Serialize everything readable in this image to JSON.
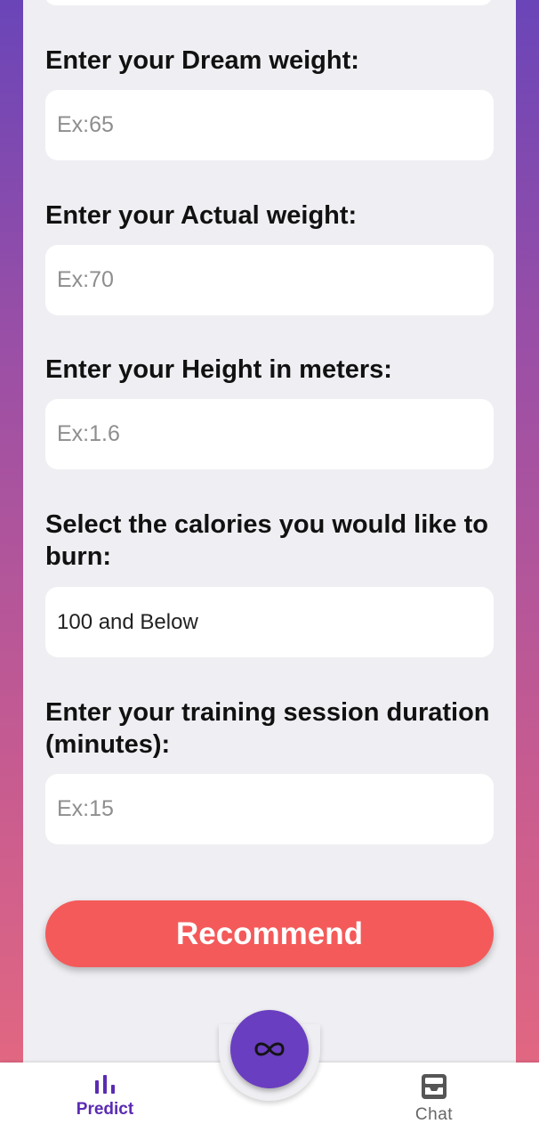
{
  "form": {
    "dream_weight": {
      "label": "Enter your Dream weight:",
      "value": "",
      "placeholder": "Ex:65"
    },
    "actual_weight": {
      "label": "Enter your Actual weight:",
      "value": "",
      "placeholder": "Ex:70"
    },
    "height": {
      "label": "Enter your Height in meters:",
      "value": "",
      "placeholder": "Ex:1.6"
    },
    "calories": {
      "label": "Select the calories you would like to burn:",
      "selected": "100 and Below"
    },
    "duration": {
      "label": "Enter your training session duration (minutes):",
      "value": "",
      "placeholder": "Ex:15"
    }
  },
  "recommend_button": {
    "label": "Recommend",
    "color": "#f45a5a"
  },
  "bottom_nav": {
    "items": [
      {
        "label": "Predict",
        "icon": "bar-chart-icon",
        "active": true,
        "color": "#5b2bb3"
      },
      {
        "label": "Chat",
        "icon": "chat-tray-icon",
        "active": false,
        "color": "#666666"
      }
    ],
    "fab_icon": "infinity-icon",
    "fab_color": "#6a3ec0"
  },
  "theme": {
    "gradient_top": "#6a45b8",
    "gradient_bottom": "#e86a7e",
    "panel_background": "#efeff3"
  }
}
